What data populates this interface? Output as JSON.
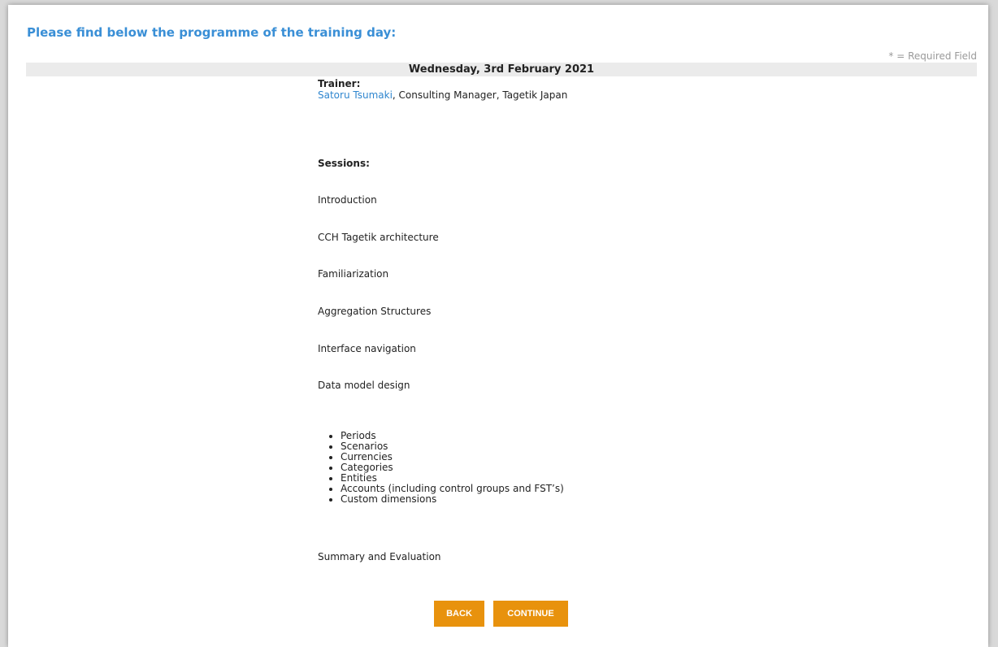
{
  "page": {
    "heading": "Please find below the programme of the training day:",
    "required_note": "* = Required Field",
    "date": "Wednesday, 3rd February 2021"
  },
  "trainer": {
    "label": "Trainer:",
    "name": "Satoru Tsumaki",
    "details": ", Consulting Manager, Tagetik Japan"
  },
  "sessions": {
    "title": "Sessions:",
    "items": [
      "Introduction",
      "CCH Tagetik architecture",
      "Familiarization",
      "Aggregation Structures",
      "Interface navigation",
      "Data model design"
    ],
    "bullets": [
      "Periods",
      "Scenarios",
      "Currencies",
      "Categories",
      "Entities",
      "Accounts (including control groups and FST’s)",
      "Custom dimensions"
    ],
    "closing": "Summary and Evaluation"
  },
  "buttons": {
    "back": "BACK",
    "continue": "CONTINUE"
  },
  "colors": {
    "heading": "#3a8fd6",
    "link": "#2f86cf",
    "button": "#e8920d",
    "date_bar": "#ebebeb"
  }
}
